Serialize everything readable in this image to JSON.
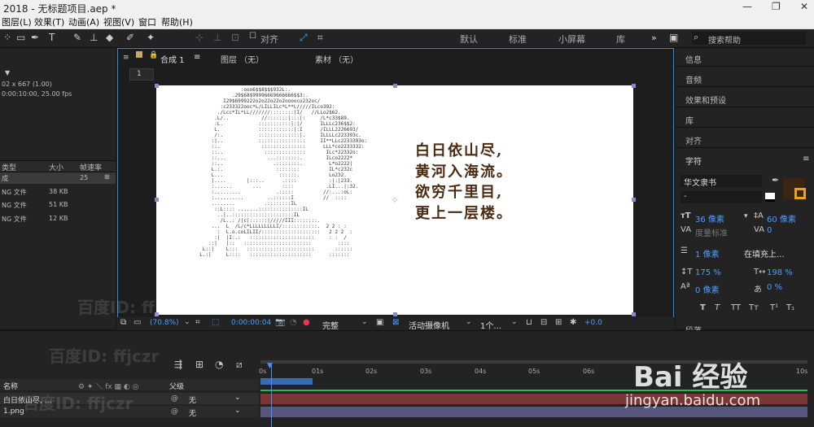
{
  "window": {
    "title": "2018 - 无标题项目.aep *",
    "min": "—",
    "restore": "❐",
    "close": "✕"
  },
  "menu": [
    "图层(L)",
    "效果(T)",
    "动画(A)",
    "视图(V)",
    "窗口",
    "帮助(H)"
  ],
  "toolbar": {
    "align_label": "对齐",
    "workspaces": [
      "默认",
      "标准",
      "小屏幕",
      "库"
    ],
    "more": "»",
    "search_placeholder": "搜索帮助"
  },
  "project": {
    "info1": "02 x 667 (1.00)",
    "info2": "0:00:10:00, 25.00 fps",
    "columns": [
      "类型",
      "大小",
      "帧速率"
    ],
    "rows": [
      {
        "type": "成",
        "size": "",
        "fps": "25"
      },
      {
        "type": "NG 文件",
        "size": "38 KB",
        "fps": ""
      },
      {
        "type": "NG 文件",
        "size": "51 KB",
        "fps": ""
      },
      {
        "type": "NG 文件",
        "size": "12 KB",
        "fps": ""
      }
    ]
  },
  "comp": {
    "tab_comp": "合成 1",
    "tab_layer": "图层 （无）",
    "tab_footage": "素材 （无）",
    "flow_label": "1",
    "poem": [
      "白日依山尽,",
      "黄河入海流。",
      "欲穷千里目,",
      "更上一层楼。"
    ],
    "ascii": "                :ooo6$$8$$$932L:.\n             .29$68$99996669666666$$3:.\n          I29$6999222o2o22o22o2ooooco232oc/\n         :c233322ooc*L/LILLILc*L**L/////ILco392:\n        ./Lcc*IL*LL///////::::::::|I/   //LLo2$62.\n       .L/..           //:::::::|:::|:     /L*c33$89.\n       :L.            :::::::::::|:|/      ILLLc236$$2:\n       L.             ::::::::::::|:I      /ILLL2226693/\n       /:.            ::::::::::::::|.     ILLLLc223393c.\n      :|..            ::::::::::::::::     II**LLc2233393o:\n      ::.              :::::::::::::::      LLL*co2233332:\n      ::..              ::::::::::::::       ILc*22332o:\n      ::...              ...::::::::.        ILco2222*\n      ::..                 .::::::::.         L*o2222|\n      L.:.                  ::::::::          IL*c232c\n      L...                   ::::::.          Lo232.\n      |....       |:::..      .::::           :|:|233.\n      :......       ...       ::::           .LI...|:32.\n      :.........            .:::::          //:...:oL:\n      :..........        ..::::::I          //  ::::\n      ........          .::::::::IL\n       ::L:::: .......:::::::::::::::IL\n        ..|..:::::::::::::::::::::IL\n         /L..: /|c|::::::|/////III::::::::.\n      ...  L  /L/c*LLLLLLLLLI/::::::::::::.  2 2 : :\n        :  L.o.coLILII/::::::::::::::::::::   2 2 2  :\n       :|  |I:.:   ::::::::::::::::::::::     : :  /\n     ::|   |::   :::::::::::::::::::::::         ::::\n   L::|    L:::   :::::::::::::::::::::::       ::::::\n  L.:|     L::::   :::::::::::::::::::::      :::::::"
  },
  "viewer": {
    "zoom": "(70.8%)",
    "timecode": "0:00:00:04",
    "resolution": "完整",
    "camera": "活动摄像机",
    "views": "1个...",
    "exposure": "+0.0"
  },
  "right_panel": {
    "sections": [
      "信息",
      "音频",
      "效果和预设",
      "库",
      "对齐",
      "字符"
    ],
    "font": "华文隶书",
    "font_style": "-",
    "font_size": "36 像素",
    "leading": "60 像素",
    "kerning": "度量标准",
    "tracking": "0",
    "stroke_width": "1 像素",
    "stroke_type": "在填充上...",
    "vscale": "175 %",
    "hscale": "198 %",
    "baseline": "0 像素",
    "tsume": "0 %",
    "styles": [
      "T",
      "T",
      "TT",
      "Tт",
      "T¹",
      "T₁"
    ],
    "paragraph": "段落"
  },
  "timeline": {
    "col_name": "名称",
    "col_parent": "父级",
    "layers": [
      {
        "name": "白日依山尽, ...",
        "parent": "无"
      },
      {
        "name": "1.png",
        "parent": "无"
      }
    ],
    "ticks": [
      "0s",
      "01s",
      "02s",
      "03s",
      "04s",
      "05s",
      "06s",
      "10s"
    ]
  },
  "watermark": {
    "baidu": "百度ID: ffjczr",
    "jingyan": "Bai 经验",
    "url": "jingyan.baidu.com"
  },
  "colors": {
    "accent": "#2d8ceb",
    "layer1": "#7a3535",
    "layer2": "#56567f",
    "canvas": "#ffffff"
  }
}
